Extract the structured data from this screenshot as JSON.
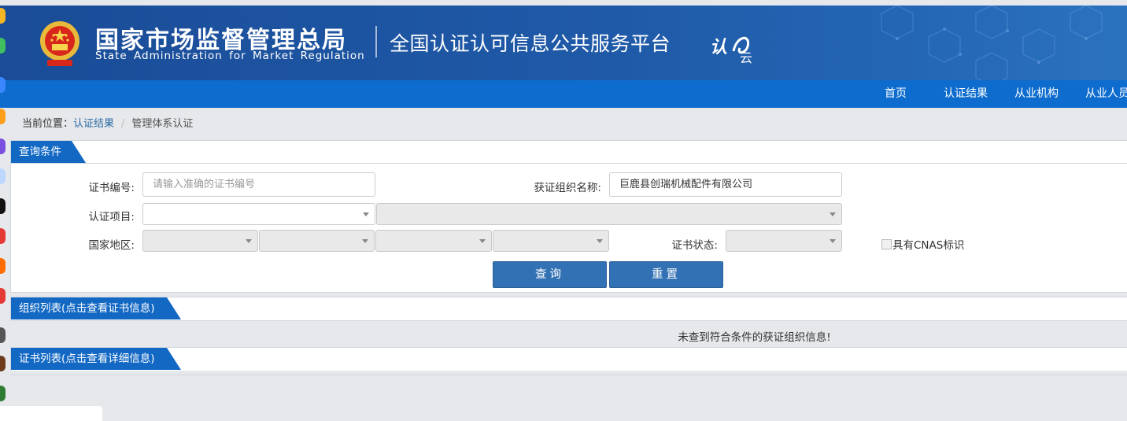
{
  "header": {
    "org_name_cn": "国家市场监督管理总局",
    "org_name_en": "State Administration  for  Market Regulation",
    "platform_title": "全国认证认可信息公共服务平台",
    "logo_text": "认云"
  },
  "nav": {
    "items": [
      "首页",
      "认证结果",
      "从业机构",
      "从业人员"
    ]
  },
  "breadcrumb": {
    "prefix": "当前位置：",
    "link": "认证结果",
    "separator": "/",
    "current": "管理体系认证"
  },
  "query": {
    "section_title": "查询条件",
    "cert_no_label": "证书编号:",
    "cert_no_placeholder": "请输入准确的证书编号",
    "cert_no_value": "",
    "org_name_label": "获证组织名称:",
    "org_name_value": "巨鹿县创瑞机械配件有限公司",
    "project_label": "认证项目:",
    "region_label": "国家地区:",
    "status_label": "证书状态:",
    "cnas_label": "具有CNAS标识",
    "search_button": "查询",
    "reset_button": "重置"
  },
  "org_list": {
    "section_title": "组织列表(点击查看证书信息)",
    "empty_message": "未查到符合条件的获证组织信息!"
  },
  "cert_list": {
    "section_title": "证书列表(点击查看详细信息)"
  },
  "colors": {
    "banner": "#1f5aa8",
    "nav": "#0d6ccd",
    "tab": "#1368c4",
    "button": "#3271b3",
    "link": "#2c6aa6"
  }
}
